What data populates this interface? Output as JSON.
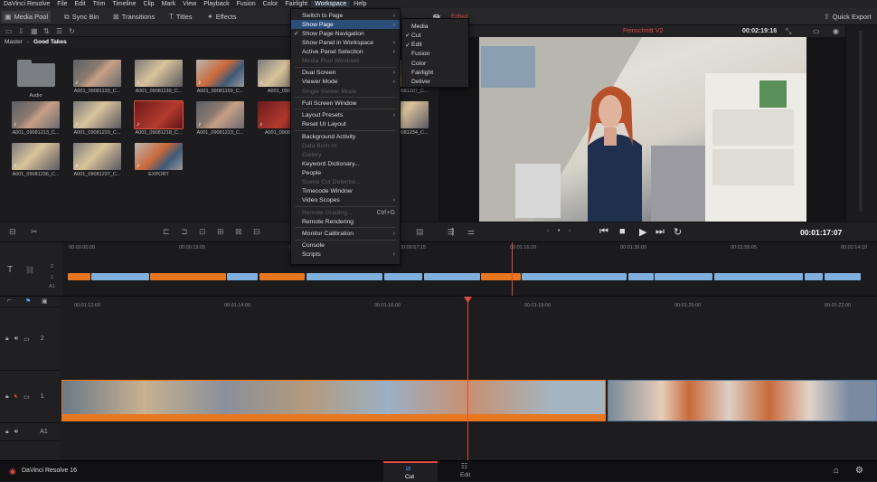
{
  "menubar": {
    "items": [
      "DaVinci Resolve",
      "File",
      "Edit",
      "Trim",
      "Timeline",
      "Clip",
      "Mark",
      "View",
      "Playback",
      "Fusion",
      "Color",
      "Fairlight",
      "Workspace",
      "Help"
    ]
  },
  "toolbar": {
    "media_pool": "Media Pool",
    "sync_bin": "Sync Bin",
    "transitions": "Transitions",
    "titles": "Titles",
    "effects": "Effects",
    "resolution": "6k",
    "edited": "Edited",
    "quick_export": "Quick Export"
  },
  "breadcrumb": {
    "root": "Master",
    "current": "Good Takes"
  },
  "clips": [
    {
      "name": "Audio",
      "kind": "folder"
    },
    {
      "name": "A001_09081133_C...",
      "kind": "person"
    },
    {
      "name": "A001_09081139_C...",
      "kind": "blonde"
    },
    {
      "name": "A001_09081159_C...",
      "kind": "orange"
    },
    {
      "name": "A001_09081",
      "kind": "blonde"
    },
    {
      "name": "A001_09081207_C...",
      "kind": "person"
    },
    {
      "name": "A001_09081213_C...",
      "kind": "person"
    },
    {
      "name": "A001_09081220_C...",
      "kind": "blonde"
    },
    {
      "name": "A001_09081218_C...",
      "kind": "red"
    },
    {
      "name": "A001_09081223_C...",
      "kind": "person"
    },
    {
      "name": "A001_0908122",
      "kind": "red"
    },
    {
      "name": "A001_09081234_C...",
      "kind": "blonde"
    },
    {
      "name": "A001_09081236_C...",
      "kind": "blonde"
    },
    {
      "name": "A001_09081237_C...",
      "kind": "blonde"
    },
    {
      "name": "EXPORT",
      "kind": "orange"
    }
  ],
  "viewer": {
    "timeline_name": "Feinschnitt V2",
    "duration": "00:02:19:16",
    "timecode": "00:01:17:07"
  },
  "upper_ruler": [
    "00:00:00:00",
    "00:00:19:05",
    "00:00:38:10",
    "00:00:57:15",
    "00:01:16:20",
    "00:01:36:00",
    "00:01:55:05",
    "00:02:14:10"
  ],
  "lower_ruler": [
    "00:01:12:00",
    "00:01:14:00",
    "00:01:16:00",
    "00:01:18:00",
    "00:01:20:00",
    "00:01:22:00"
  ],
  "tracks": {
    "v2": "2",
    "v1": "1",
    "a1": "A1"
  },
  "workspace_menu": {
    "items": [
      {
        "label": "Switch to Page",
        "arrow": true
      },
      {
        "label": "Show Page",
        "arrow": true,
        "highlight": true
      },
      {
        "label": "Show Page Navigation",
        "check": true
      },
      {
        "label": "Show Panel in Workspace",
        "arrow": true
      },
      {
        "label": "Active Panel Selection",
        "arrow": true
      },
      {
        "label": "Media Pool Windows",
        "disabled": true
      },
      {
        "label": "Dual Screen",
        "arrow": true
      },
      {
        "label": "Viewer Mode",
        "arrow": true
      },
      {
        "label": "Single Viewer Mode",
        "disabled": true
      },
      {
        "label": "Full Screen Window"
      },
      {
        "label": "Layout Presets",
        "arrow": true
      },
      {
        "label": "Reset UI Layout"
      },
      {
        "label": "Background Activity"
      },
      {
        "label": "Data Burn-In",
        "disabled": true
      },
      {
        "label": "Gallery",
        "disabled": true
      },
      {
        "label": "Keyword Dictionary..."
      },
      {
        "label": "People"
      },
      {
        "label": "Scene Cut Detector...",
        "disabled": true
      },
      {
        "label": "Timecode Window"
      },
      {
        "label": "Video Scopes",
        "arrow": true
      },
      {
        "label": "Remote Grading...",
        "disabled": true,
        "shortcut": "Ctrl+G"
      },
      {
        "label": "Remote Rendering"
      },
      {
        "label": "Monitor Calibration",
        "arrow": true
      },
      {
        "label": "Console"
      },
      {
        "label": "Scripts",
        "arrow": true
      }
    ]
  },
  "show_page_submenu": {
    "items": [
      {
        "label": "Media"
      },
      {
        "label": "Cut",
        "check": true
      },
      {
        "label": "Edit",
        "check": true
      },
      {
        "label": "Fusion"
      },
      {
        "label": "Color"
      },
      {
        "label": "Fairlight"
      },
      {
        "label": "Deliver"
      }
    ]
  },
  "bottom": {
    "app": "DaVinci Resolve 16",
    "page_cut": "Cut",
    "page_edit": "Edit"
  },
  "colors": {
    "accent": "#e04a40",
    "orange": "#e8771e",
    "blue": "#7fb0de",
    "highlight": "#2a4d7a"
  }
}
